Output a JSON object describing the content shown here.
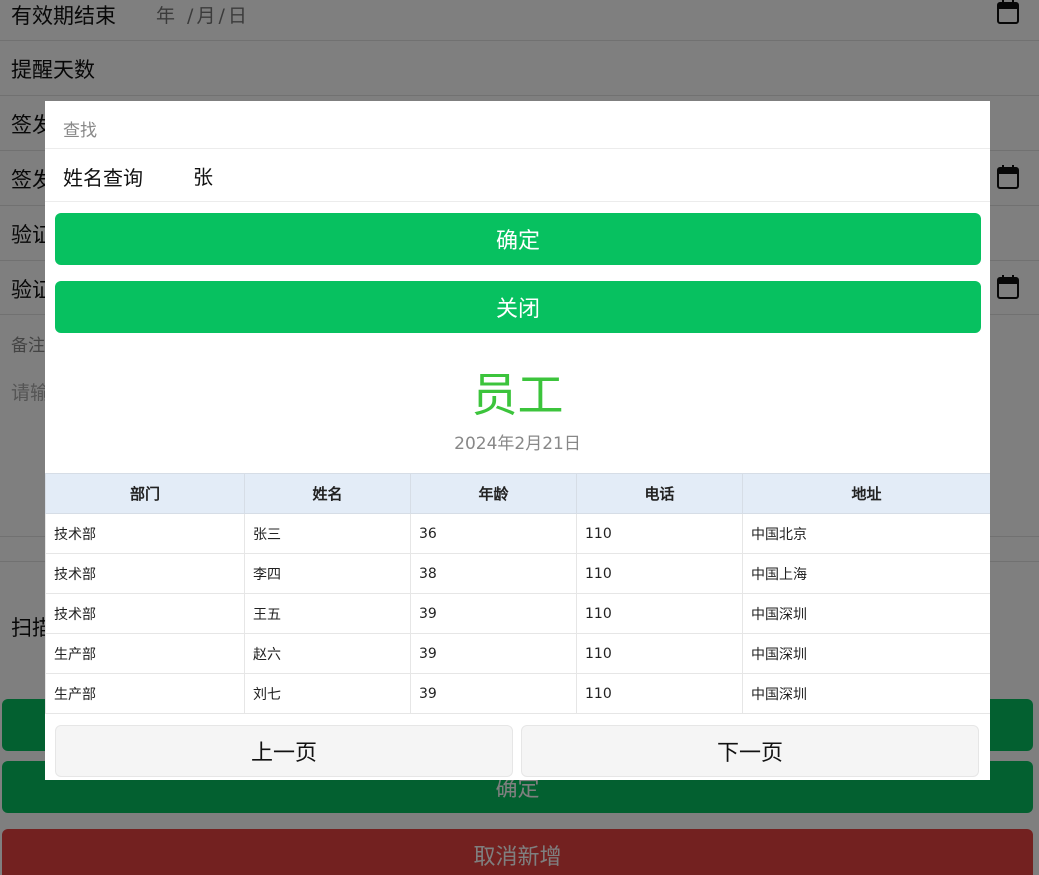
{
  "form": {
    "validity_end_label": "有效期结束",
    "validity_end_value": "年 /月/日",
    "remind_days_label": "提醒天数",
    "row_labels": [
      "签发",
      "签发",
      "验证",
      "验证"
    ],
    "remark_title": "备注",
    "remark_placeholder": "请输",
    "scan_label": "扫描",
    "confirm_label": "确定",
    "cancel_label": "取消新增"
  },
  "dialog": {
    "header": "查找",
    "search_label": "姓名查询",
    "search_value": "张",
    "confirm_label": "确定",
    "close_label": "关闭",
    "title": "员工",
    "date": "2024年2月21日",
    "table": {
      "headers": [
        "部门",
        "姓名",
        "年龄",
        "电话",
        "地址"
      ],
      "rows": [
        [
          "技术部",
          "张三",
          "36",
          "110",
          "中国北京"
        ],
        [
          "技术部",
          "李四",
          "38",
          "110",
          "中国上海"
        ],
        [
          "技术部",
          "王五",
          "39",
          "110",
          "中国深圳"
        ],
        [
          "生产部",
          "赵六",
          "39",
          "110",
          "中国深圳"
        ],
        [
          "生产部",
          "刘七",
          "39",
          "110",
          "中国深圳"
        ]
      ]
    },
    "prev_label": "上一页",
    "next_label": "下一页"
  },
  "colors": {
    "primary_green": "#07c160",
    "danger_red": "#e64340",
    "title_green": "#3cc43c",
    "table_header_bg": "#e3ecf7"
  },
  "icons": [
    "calendar-icon"
  ]
}
